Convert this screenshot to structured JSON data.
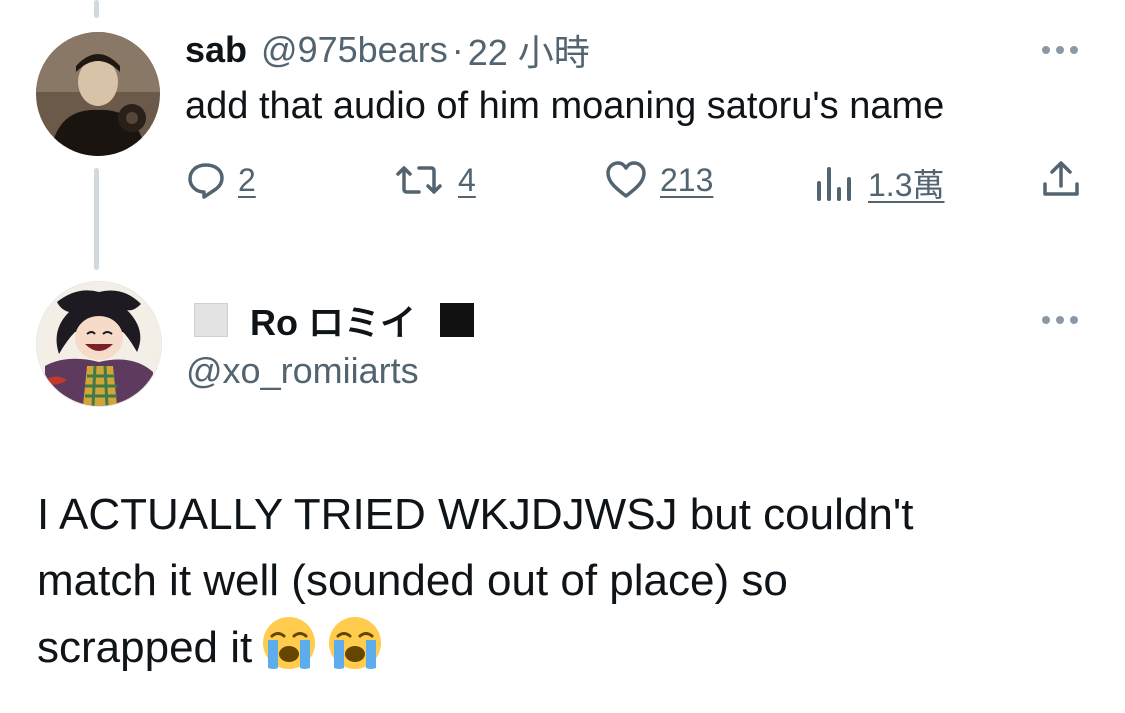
{
  "reply": {
    "display_name": "sab",
    "handle": "@975bears",
    "separator": "·",
    "timestamp": "22 小時",
    "text": "add that audio of him moaning satoru's name",
    "actions": {
      "replies": "2",
      "reposts": "4",
      "likes": "213",
      "views": "1.3萬"
    }
  },
  "main_tweet": {
    "display_name_prefix": "◻️",
    "display_name": "Ro ロミイ",
    "display_name_suffix": "◼️",
    "handle": "@xo_romiiarts",
    "text": "I ACTUALLY TRIED WKJDJWSJ but couldn't\nmatch it well (sounded out of place) so\nscrapped it",
    "emojis": [
      "loudly-crying-face",
      "loudly-crying-face"
    ]
  },
  "colors": {
    "text": "#0f1419",
    "secondary": "#536471",
    "thread_line": "#cfd9de"
  },
  "icons": [
    "more-icon",
    "reply-icon",
    "repost-icon",
    "like-icon",
    "views-icon",
    "share-icon"
  ]
}
